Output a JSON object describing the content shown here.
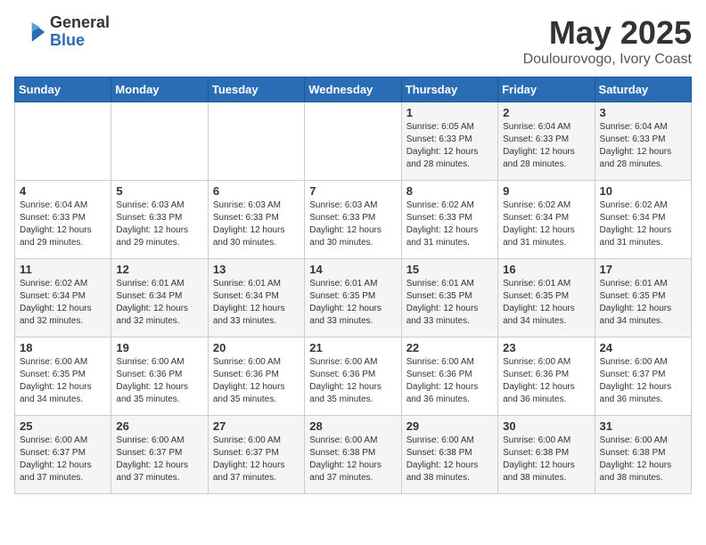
{
  "header": {
    "logo_general": "General",
    "logo_blue": "Blue",
    "title": "May 2025",
    "subtitle": "Doulourovogo, Ivory Coast"
  },
  "weekdays": [
    "Sunday",
    "Monday",
    "Tuesday",
    "Wednesday",
    "Thursday",
    "Friday",
    "Saturday"
  ],
  "weeks": [
    [
      {
        "day": "",
        "info": ""
      },
      {
        "day": "",
        "info": ""
      },
      {
        "day": "",
        "info": ""
      },
      {
        "day": "",
        "info": ""
      },
      {
        "day": "1",
        "info": "Sunrise: 6:05 AM\nSunset: 6:33 PM\nDaylight: 12 hours\nand 28 minutes."
      },
      {
        "day": "2",
        "info": "Sunrise: 6:04 AM\nSunset: 6:33 PM\nDaylight: 12 hours\nand 28 minutes."
      },
      {
        "day": "3",
        "info": "Sunrise: 6:04 AM\nSunset: 6:33 PM\nDaylight: 12 hours\nand 28 minutes."
      }
    ],
    [
      {
        "day": "4",
        "info": "Sunrise: 6:04 AM\nSunset: 6:33 PM\nDaylight: 12 hours\nand 29 minutes."
      },
      {
        "day": "5",
        "info": "Sunrise: 6:03 AM\nSunset: 6:33 PM\nDaylight: 12 hours\nand 29 minutes."
      },
      {
        "day": "6",
        "info": "Sunrise: 6:03 AM\nSunset: 6:33 PM\nDaylight: 12 hours\nand 30 minutes."
      },
      {
        "day": "7",
        "info": "Sunrise: 6:03 AM\nSunset: 6:33 PM\nDaylight: 12 hours\nand 30 minutes."
      },
      {
        "day": "8",
        "info": "Sunrise: 6:02 AM\nSunset: 6:33 PM\nDaylight: 12 hours\nand 31 minutes."
      },
      {
        "day": "9",
        "info": "Sunrise: 6:02 AM\nSunset: 6:34 PM\nDaylight: 12 hours\nand 31 minutes."
      },
      {
        "day": "10",
        "info": "Sunrise: 6:02 AM\nSunset: 6:34 PM\nDaylight: 12 hours\nand 31 minutes."
      }
    ],
    [
      {
        "day": "11",
        "info": "Sunrise: 6:02 AM\nSunset: 6:34 PM\nDaylight: 12 hours\nand 32 minutes."
      },
      {
        "day": "12",
        "info": "Sunrise: 6:01 AM\nSunset: 6:34 PM\nDaylight: 12 hours\nand 32 minutes."
      },
      {
        "day": "13",
        "info": "Sunrise: 6:01 AM\nSunset: 6:34 PM\nDaylight: 12 hours\nand 33 minutes."
      },
      {
        "day": "14",
        "info": "Sunrise: 6:01 AM\nSunset: 6:35 PM\nDaylight: 12 hours\nand 33 minutes."
      },
      {
        "day": "15",
        "info": "Sunrise: 6:01 AM\nSunset: 6:35 PM\nDaylight: 12 hours\nand 33 minutes."
      },
      {
        "day": "16",
        "info": "Sunrise: 6:01 AM\nSunset: 6:35 PM\nDaylight: 12 hours\nand 34 minutes."
      },
      {
        "day": "17",
        "info": "Sunrise: 6:01 AM\nSunset: 6:35 PM\nDaylight: 12 hours\nand 34 minutes."
      }
    ],
    [
      {
        "day": "18",
        "info": "Sunrise: 6:00 AM\nSunset: 6:35 PM\nDaylight: 12 hours\nand 34 minutes."
      },
      {
        "day": "19",
        "info": "Sunrise: 6:00 AM\nSunset: 6:36 PM\nDaylight: 12 hours\nand 35 minutes."
      },
      {
        "day": "20",
        "info": "Sunrise: 6:00 AM\nSunset: 6:36 PM\nDaylight: 12 hours\nand 35 minutes."
      },
      {
        "day": "21",
        "info": "Sunrise: 6:00 AM\nSunset: 6:36 PM\nDaylight: 12 hours\nand 35 minutes."
      },
      {
        "day": "22",
        "info": "Sunrise: 6:00 AM\nSunset: 6:36 PM\nDaylight: 12 hours\nand 36 minutes."
      },
      {
        "day": "23",
        "info": "Sunrise: 6:00 AM\nSunset: 6:36 PM\nDaylight: 12 hours\nand 36 minutes."
      },
      {
        "day": "24",
        "info": "Sunrise: 6:00 AM\nSunset: 6:37 PM\nDaylight: 12 hours\nand 36 minutes."
      }
    ],
    [
      {
        "day": "25",
        "info": "Sunrise: 6:00 AM\nSunset: 6:37 PM\nDaylight: 12 hours\nand 37 minutes."
      },
      {
        "day": "26",
        "info": "Sunrise: 6:00 AM\nSunset: 6:37 PM\nDaylight: 12 hours\nand 37 minutes."
      },
      {
        "day": "27",
        "info": "Sunrise: 6:00 AM\nSunset: 6:37 PM\nDaylight: 12 hours\nand 37 minutes."
      },
      {
        "day": "28",
        "info": "Sunrise: 6:00 AM\nSunset: 6:38 PM\nDaylight: 12 hours\nand 37 minutes."
      },
      {
        "day": "29",
        "info": "Sunrise: 6:00 AM\nSunset: 6:38 PM\nDaylight: 12 hours\nand 38 minutes."
      },
      {
        "day": "30",
        "info": "Sunrise: 6:00 AM\nSunset: 6:38 PM\nDaylight: 12 hours\nand 38 minutes."
      },
      {
        "day": "31",
        "info": "Sunrise: 6:00 AM\nSunset: 6:38 PM\nDaylight: 12 hours\nand 38 minutes."
      }
    ]
  ]
}
